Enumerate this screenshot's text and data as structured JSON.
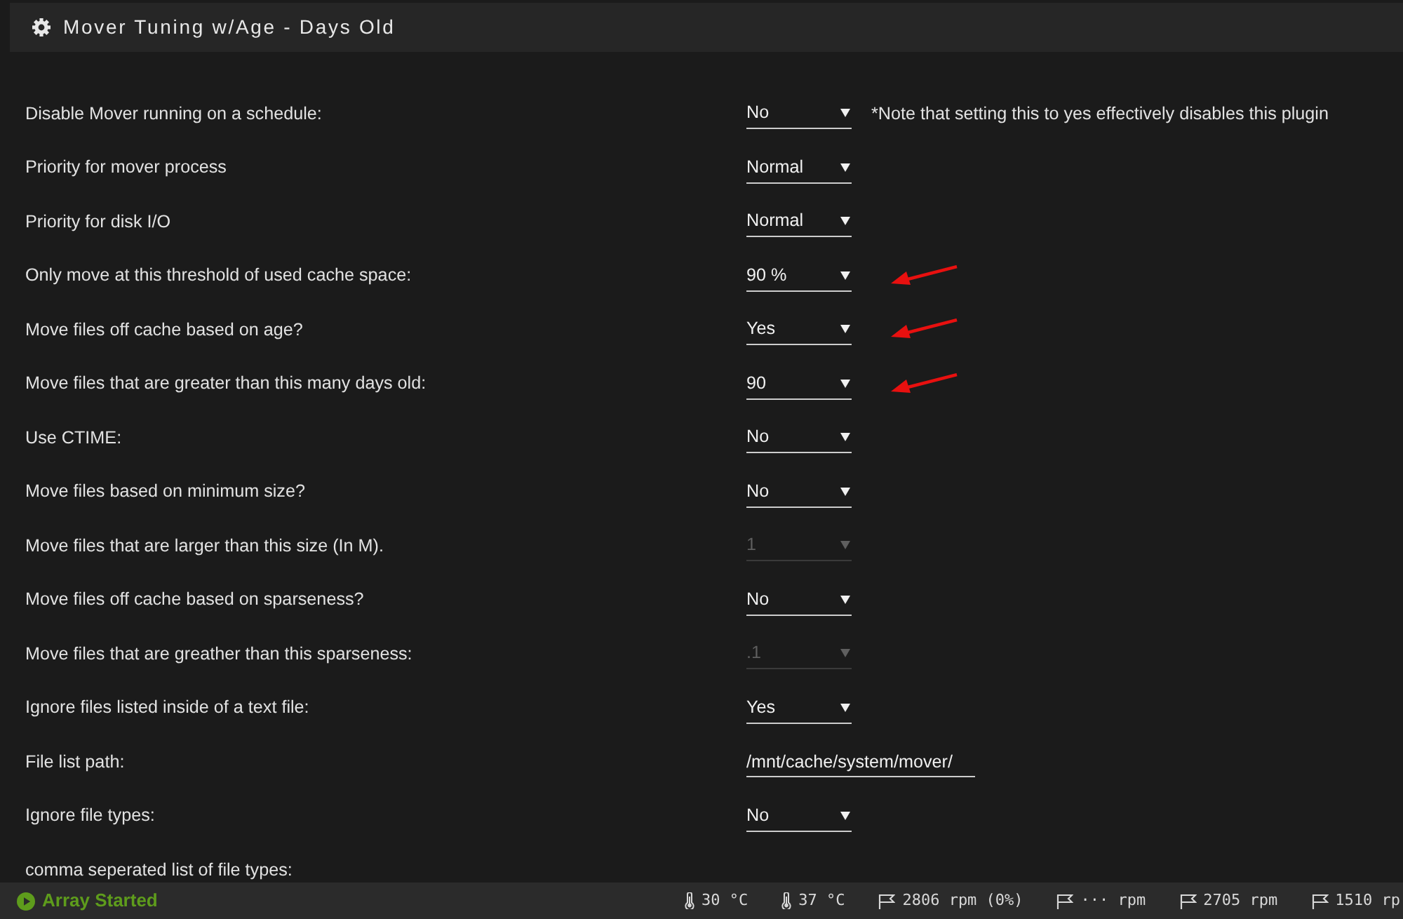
{
  "panel": {
    "title": "Mover Tuning w/Age - Days Old"
  },
  "settings": [
    {
      "label": "Disable Mover running on a schedule:",
      "control": {
        "kind": "select",
        "value": "No",
        "disabled": false
      },
      "note": "*Note that setting this to yes effectively disables this plugin",
      "marked": false
    },
    {
      "label": "Priority for mover process",
      "control": {
        "kind": "select",
        "value": "Normal",
        "disabled": false
      },
      "marked": false
    },
    {
      "label": "Priority for disk I/O",
      "control": {
        "kind": "select",
        "value": "Normal",
        "disabled": false
      },
      "marked": false
    },
    {
      "label": "Only move at this threshold of used cache space:",
      "control": {
        "kind": "select",
        "value": "90 %",
        "disabled": false
      },
      "marked": true
    },
    {
      "label": "Move files off cache based on age?",
      "control": {
        "kind": "select",
        "value": "Yes",
        "disabled": false
      },
      "marked": true
    },
    {
      "label": "Move files that are greater than this many days old:",
      "control": {
        "kind": "select",
        "value": "90",
        "disabled": false
      },
      "marked": true
    },
    {
      "label": "Use CTIME:",
      "control": {
        "kind": "select",
        "value": "No",
        "disabled": false
      },
      "marked": false
    },
    {
      "label": "Move files based on minimum size?",
      "control": {
        "kind": "select",
        "value": "No",
        "disabled": false
      },
      "marked": false
    },
    {
      "label": "Move files that are larger than this size (In M).",
      "control": {
        "kind": "select",
        "value": "1",
        "disabled": true
      },
      "marked": false
    },
    {
      "label": "Move files off cache based on sparseness?",
      "control": {
        "kind": "select",
        "value": "No",
        "disabled": false
      },
      "marked": false
    },
    {
      "label": "Move files that are greather than this sparseness:",
      "control": {
        "kind": "select",
        "value": ".1",
        "disabled": true
      },
      "marked": false
    },
    {
      "label": "Ignore files listed inside of a text file:",
      "control": {
        "kind": "select",
        "value": "Yes",
        "disabled": false
      },
      "marked": false
    },
    {
      "label": "File list path:",
      "control": {
        "kind": "text",
        "value": "/mnt/cache/system/mover/",
        "disabled": false
      },
      "marked": false
    },
    {
      "label": "Ignore file types:",
      "control": {
        "kind": "select",
        "value": "No",
        "disabled": false
      },
      "marked": false
    },
    {
      "label": "comma seperated list of file types:",
      "marked": false
    }
  ],
  "status_bar": {
    "status": "Array Started",
    "readings": [
      {
        "kind": "temperature",
        "text": "30 °C"
      },
      {
        "kind": "temperature",
        "text": "37 °C"
      },
      {
        "kind": "fan",
        "text": "2806 rpm (0%)"
      },
      {
        "kind": "fan",
        "text": "··· rpm"
      },
      {
        "kind": "fan",
        "text": "2705 rpm"
      },
      {
        "kind": "fan",
        "text": "1510 rp"
      }
    ]
  }
}
